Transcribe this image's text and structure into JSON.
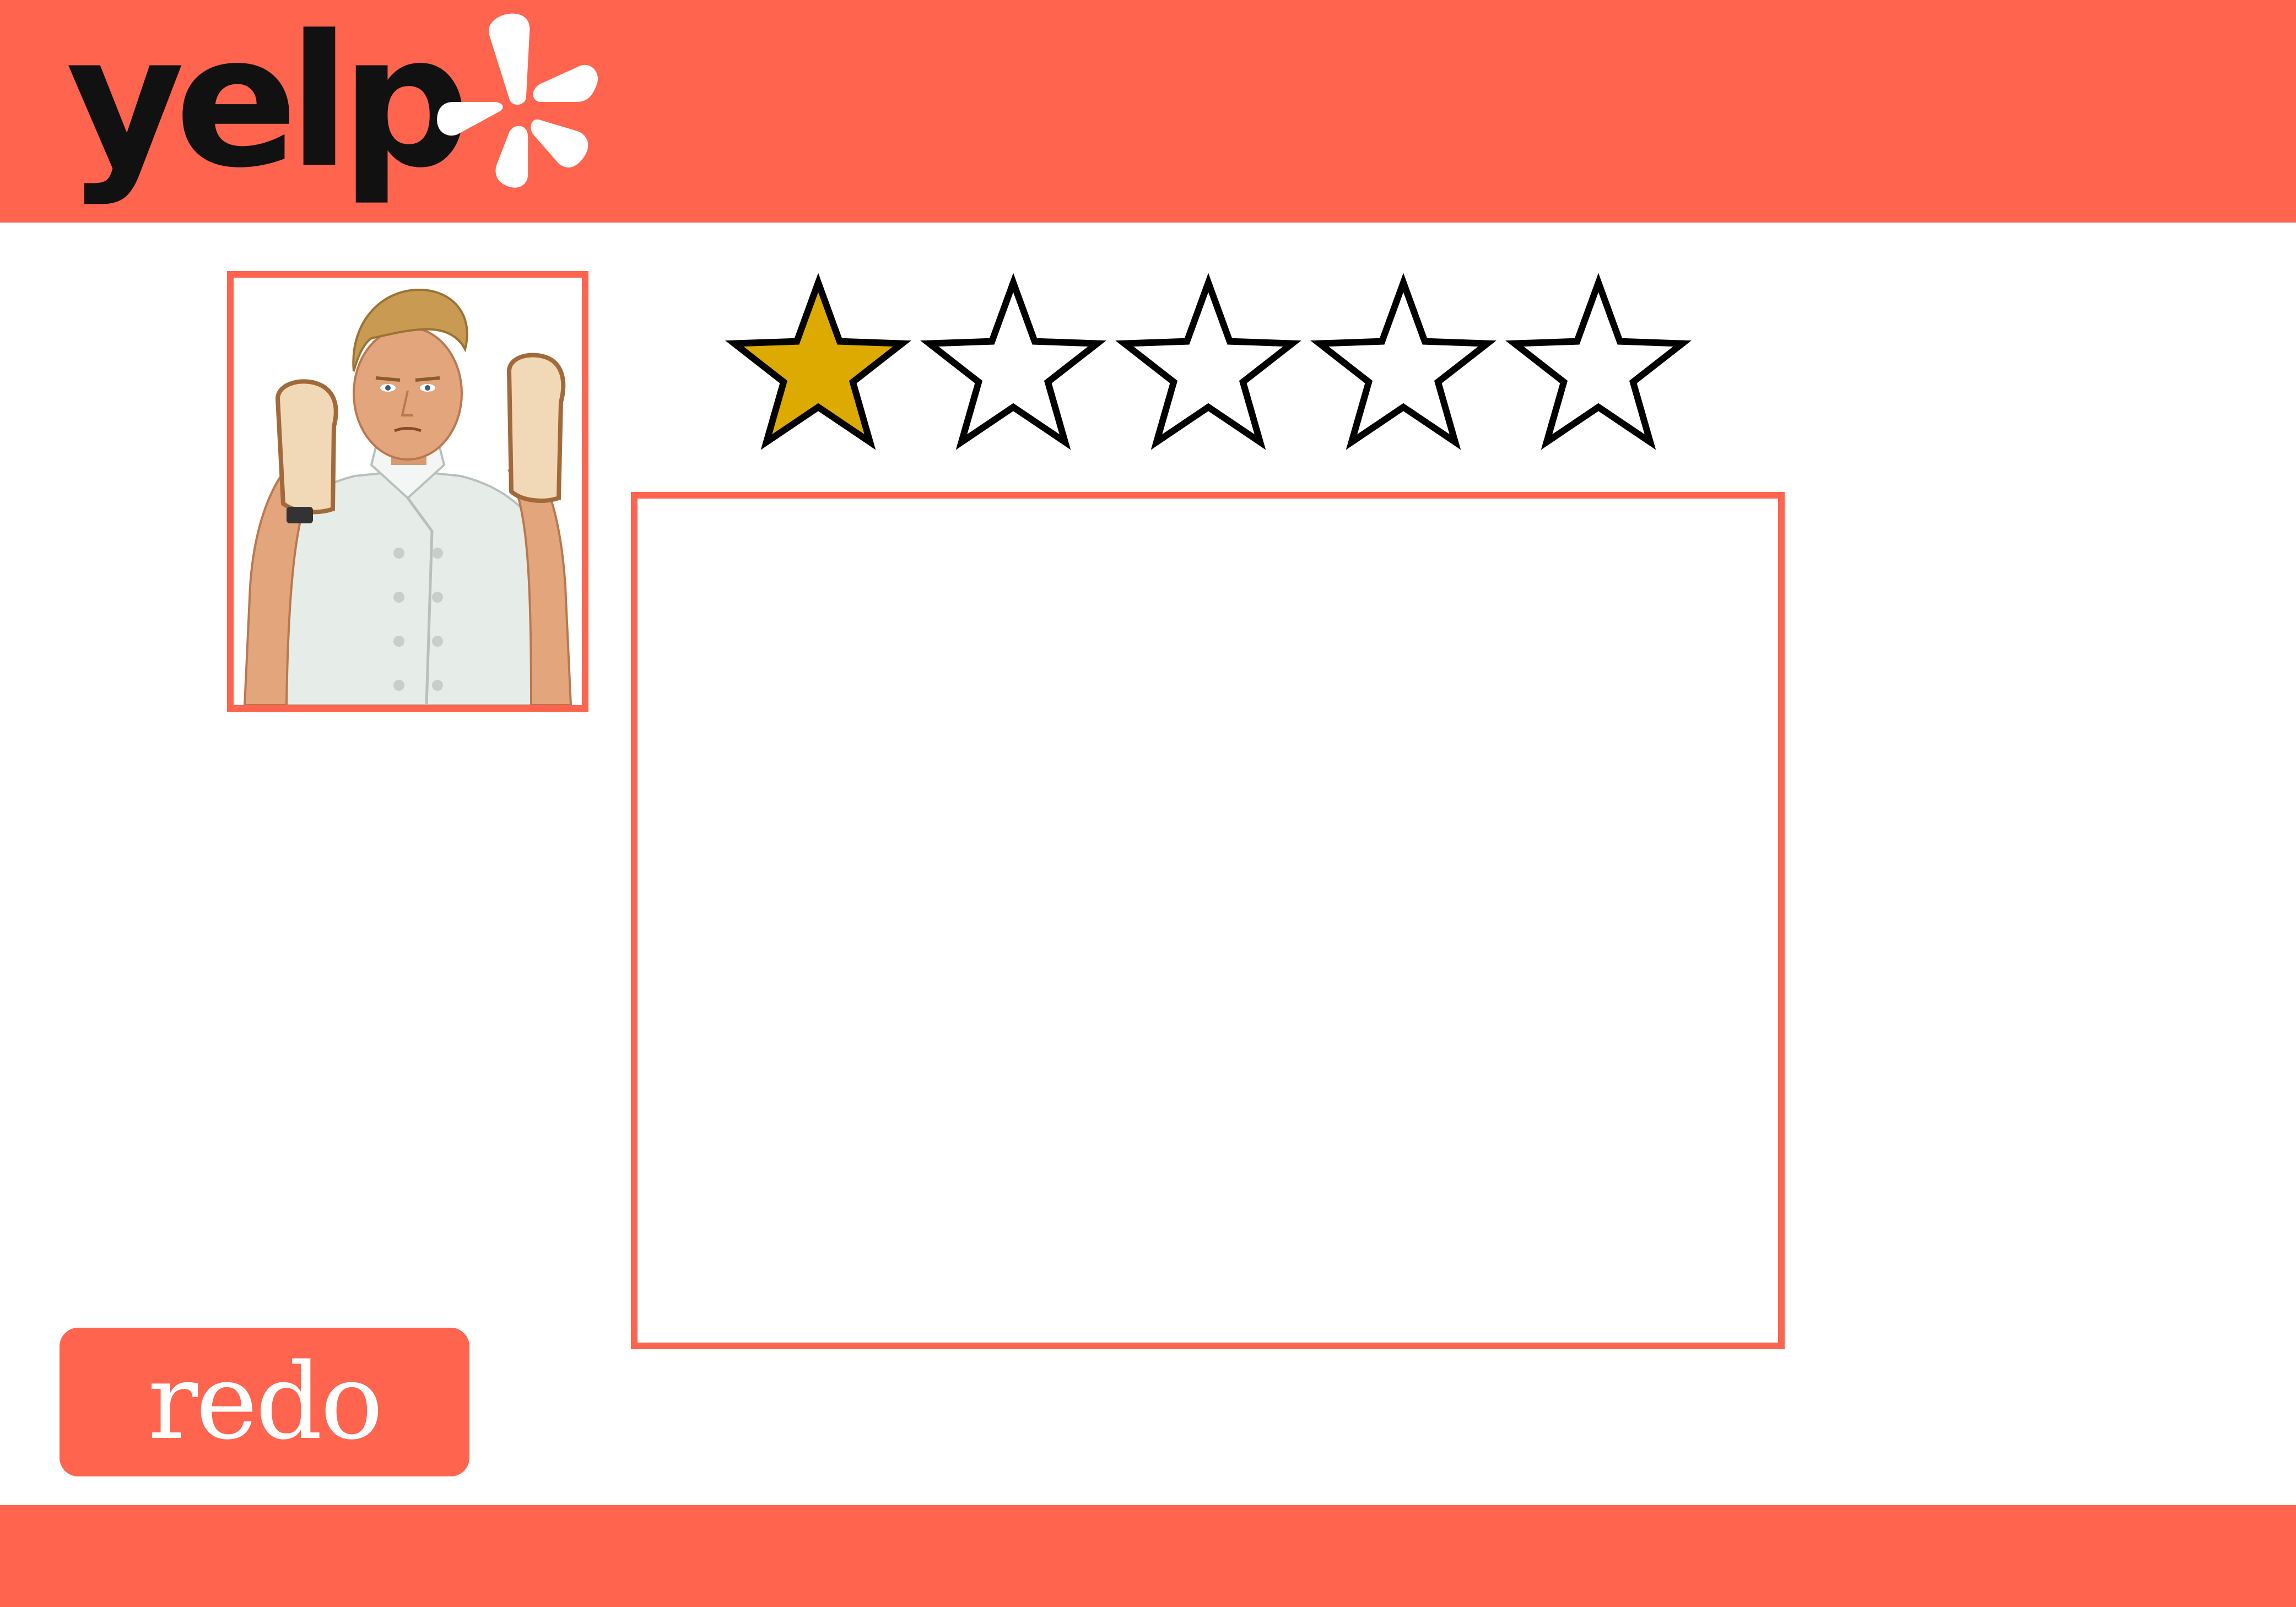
{
  "header": {
    "brand_color": "#ff644e",
    "logo_text": "yelp",
    "logo_icon": "yelp-burst-icon"
  },
  "reviewer": {
    "avatar_icon": "chef-avatar"
  },
  "rating": {
    "value": 1,
    "max": 5,
    "filled_color": "#dcaa00",
    "empty_color": "#ffffff"
  },
  "review": {
    "text": ""
  },
  "actions": {
    "redo_label": "redo"
  },
  "footer": {
    "color": "#ff644e"
  }
}
